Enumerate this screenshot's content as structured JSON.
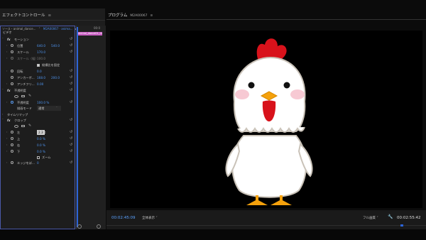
{
  "effect_controls": {
    "title": "エフェクトコントロール",
    "menu_icon": "≡",
    "source_label": "ソース・animal_dance...",
    "sequence_label": "M2A00067 · anima...",
    "timecode": "00:0",
    "clip_name": "animal_dance01_m",
    "section_video": "ビデオ",
    "motion": {
      "name": "モーション",
      "position_label": "位置",
      "position_x": "640.0",
      "position_y": "540.0",
      "scale_label": "スケール",
      "scale_value": "170.0",
      "scale_width_label": "スケール（幅）",
      "scale_width_value": "100.0",
      "uniform_scale_label": "縦横比を固定",
      "rotation_label": "回転",
      "rotation_value": "0.0",
      "anchor_label": "アンカーポ...",
      "anchor_x": "168.0",
      "anchor_y": "200.0",
      "antiflicker_label": "アンチフリ...",
      "antiflicker_value": "0.00"
    },
    "opacity": {
      "name": "不透明度",
      "opacity_label": "不透明度",
      "opacity_value": "100.0 %",
      "blend_label": "描画モード",
      "blend_value": "通常"
    },
    "time_remap": "タイムリマップ",
    "crop": {
      "name": "クロップ",
      "left_label": "左",
      "left_value": "2.3",
      "top_label": "上",
      "top_value": "0.0 %",
      "right_label": "右",
      "right_value": "0.0 %",
      "bottom_label": "下",
      "bottom_value": "0.0 %",
      "zoom_label": "ズーム",
      "edge_label": "エッジをぼ...",
      "edge_value": "0"
    }
  },
  "program_monitor": {
    "title": "プログラム",
    "sequence": "M2A00067",
    "menu_icon": "≡",
    "timecode_current": "00:02:45:09",
    "fit_label": "全体表示",
    "quality_label": "フル画質",
    "timecode_duration": "00:02:55:42"
  },
  "colors": {
    "timecode_blue": "#5ba2ff",
    "value_blue": "#4f96f2",
    "clip_pink": "#c95fc3",
    "playhead_blue": "#2c64d8"
  }
}
